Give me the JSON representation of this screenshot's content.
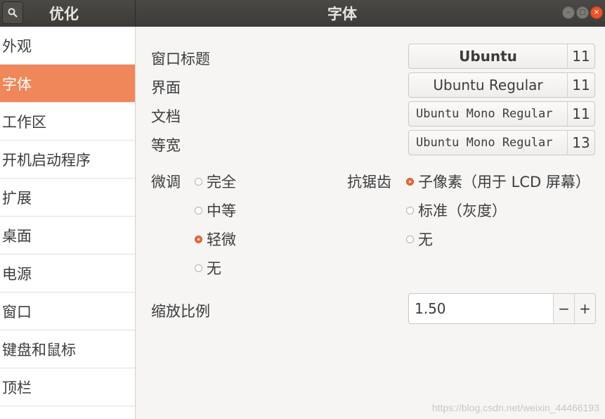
{
  "header": {
    "left_title": "优化",
    "main_title": "字体",
    "wm": {
      "minimize": "–",
      "maximize": "□",
      "close": "×"
    }
  },
  "sidebar": {
    "items": [
      {
        "label": "外观"
      },
      {
        "label": "字体"
      },
      {
        "label": "工作区"
      },
      {
        "label": "开机启动程序"
      },
      {
        "label": "扩展"
      },
      {
        "label": "桌面"
      },
      {
        "label": "电源"
      },
      {
        "label": "窗口"
      },
      {
        "label": "键盘和鼠标"
      },
      {
        "label": "顶栏"
      }
    ],
    "active_index": 1
  },
  "fonts": [
    {
      "label": "窗口标题",
      "font": "Ubuntu",
      "size": "11"
    },
    {
      "label": "界面",
      "font": "Ubuntu Regular",
      "size": "11"
    },
    {
      "label": "文档",
      "font": "Ubuntu Mono Regular",
      "size": "11"
    },
    {
      "label": "等宽",
      "font": "Ubuntu Mono Regular",
      "size": "13"
    }
  ],
  "hinting": {
    "label": "微调",
    "options": [
      "完全",
      "中等",
      "轻微",
      "无"
    ],
    "selected": "轻微"
  },
  "antialiasing": {
    "label": "抗锯齿",
    "options": [
      "子像素（用于 LCD 屏幕）",
      "标准（灰度）",
      "无"
    ],
    "selected": "子像素（用于 LCD 屏幕）"
  },
  "scaling": {
    "label": "缩放比例",
    "value": "1.50",
    "minus": "−",
    "plus": "+"
  },
  "watermark": "https://blog.csdn.net/weixin_44466193",
  "colors": {
    "accent": "#f0875a",
    "header": "#3c3b37",
    "close": "#e9562a"
  }
}
